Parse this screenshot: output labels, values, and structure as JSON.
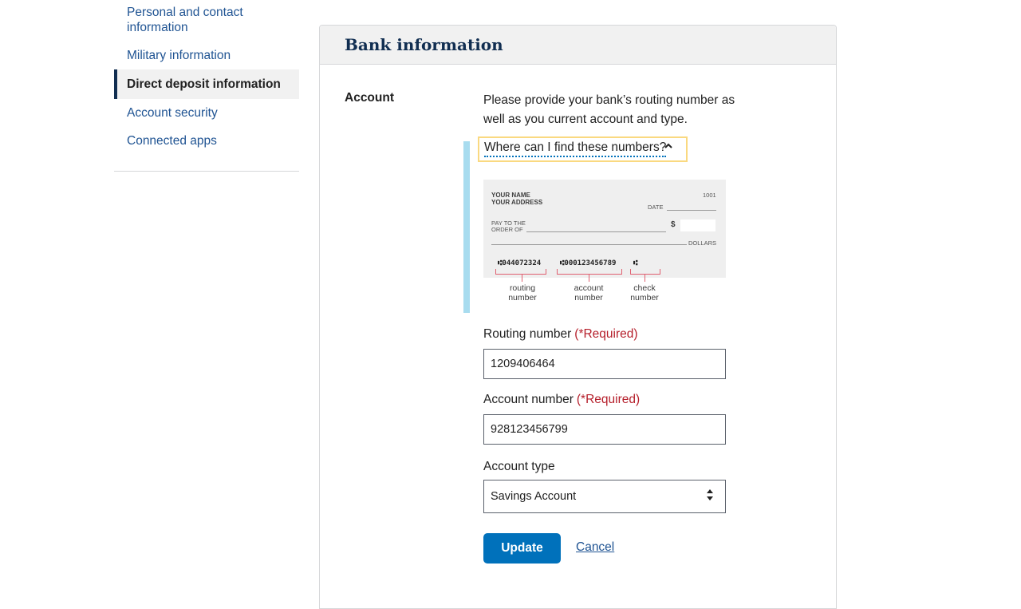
{
  "sidebar": {
    "items": [
      {
        "label": "Personal and contact information"
      },
      {
        "label": "Military information"
      },
      {
        "label": "Direct deposit information"
      },
      {
        "label": "Account security"
      },
      {
        "label": "Connected apps"
      }
    ],
    "active_index": 2
  },
  "card": {
    "title": "Bank information",
    "account_label": "Account",
    "intro": "Please provide your bank’s routing number as well as you current account and type.",
    "find_numbers": "Where can I find these numbers?",
    "check": {
      "name_line": "YOUR NAME",
      "address_line": "YOUR ADDRESS",
      "check_no": "1001",
      "date": "DATE",
      "pay_to_1": "PAY TO THE",
      "pay_to_2": "ORDER OF",
      "dollar_sign": "$",
      "dollars": "DOLLARS",
      "routing_micr": "⑆044072324",
      "account_micr": "⑆000123456789",
      "check_micr": "⑆",
      "routing_caption": "routing number",
      "account_caption": "account number",
      "check_caption": "check number"
    },
    "routing": {
      "label": "Routing number",
      "required": "(*Required)",
      "value": "1209406464"
    },
    "account": {
      "label": "Account number",
      "required": "(*Required)",
      "value": "928123456799"
    },
    "account_type": {
      "label": "Account type",
      "value": "Savings Account"
    },
    "update_label": "Update",
    "cancel_label": "Cancel"
  },
  "colors": {
    "link": "#205493",
    "heading": "#112e51",
    "primary_button": "#0071bb",
    "required": "#b51e2a",
    "focus_outline": "#fad980",
    "accordion_bar": "#a8dcef"
  }
}
